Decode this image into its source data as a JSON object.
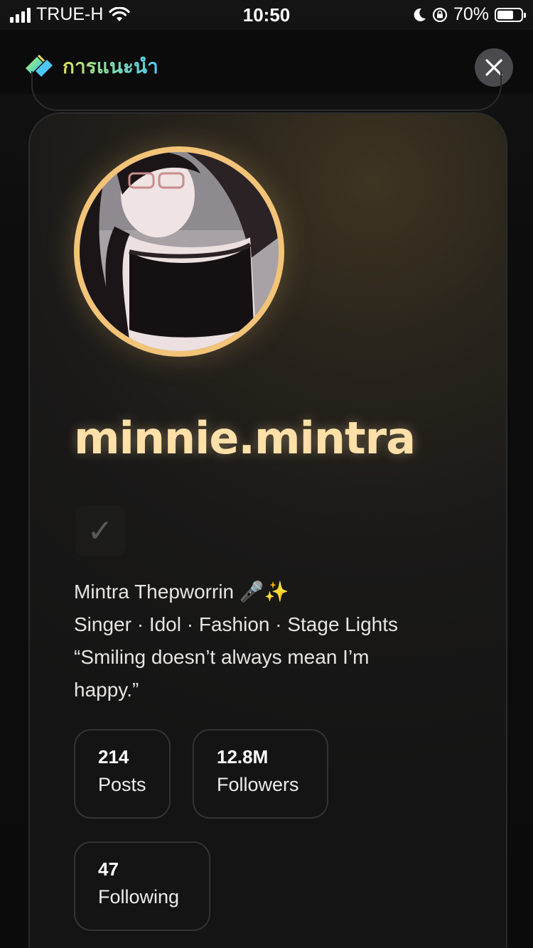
{
  "status_bar": {
    "carrier": "TRUE-H",
    "time": "10:50",
    "battery_percent": "70%",
    "battery_level": 0.7,
    "icons": [
      "signal-icon",
      "wifi-icon",
      "moon-icon",
      "orientation-lock-icon",
      "battery-icon"
    ]
  },
  "header": {
    "brand_label": "การแนะนำ",
    "close_icon": "close-icon"
  },
  "profile": {
    "username": "minnie.mintra",
    "verified_mark": "✓",
    "bio_lines": [
      "Mintra Thepworrin 🎤✨",
      "Singer · Idol · Fashion · Stage Lights",
      "“Smiling doesn’t always mean I’m",
      "happy.”"
    ],
    "stats": [
      {
        "value": "214",
        "label": "Posts"
      },
      {
        "value": "12.8M",
        "label": "Followers"
      },
      {
        "value": "47",
        "label": "Following"
      }
    ]
  },
  "colors": {
    "accent": "#f3c477",
    "username": "#ffe0a8",
    "card_border": "#2b2b2b"
  }
}
